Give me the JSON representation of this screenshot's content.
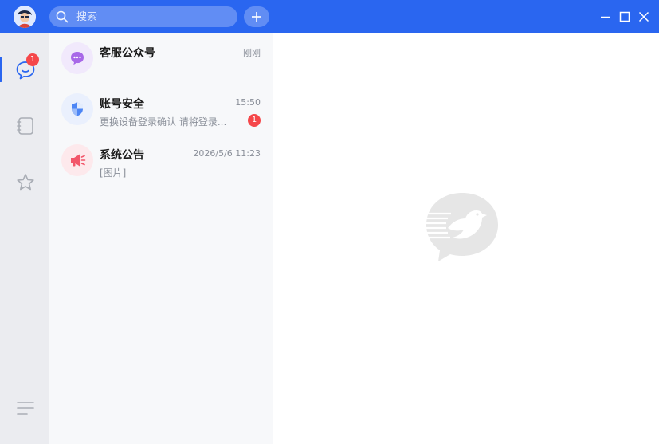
{
  "titlebar": {
    "search_placeholder": "搜索",
    "accent_color": "#2a66f0"
  },
  "rail": {
    "items": [
      {
        "icon": "chat-bubble-icon",
        "active": true,
        "badge": "1"
      },
      {
        "icon": "contacts-book-icon",
        "active": false
      },
      {
        "icon": "star-icon",
        "active": false
      }
    ],
    "bottom_icon": "menu-icon"
  },
  "conversations": [
    {
      "name": "客服公众号",
      "time": "刚刚",
      "preview": "",
      "badge": "",
      "avatar_icon": "customer-service-icon"
    },
    {
      "name": "账号安全",
      "time": "15:50",
      "preview": "更换设备登录确认 请将登录...",
      "badge": "1",
      "avatar_icon": "shield-icon"
    },
    {
      "name": "系统公告",
      "time": "2026/5/6 11:23",
      "preview": "[图片]",
      "badge": "",
      "avatar_icon": "megaphone-icon"
    }
  ],
  "main": {
    "watermark_icon": "bird-logo-icon"
  }
}
